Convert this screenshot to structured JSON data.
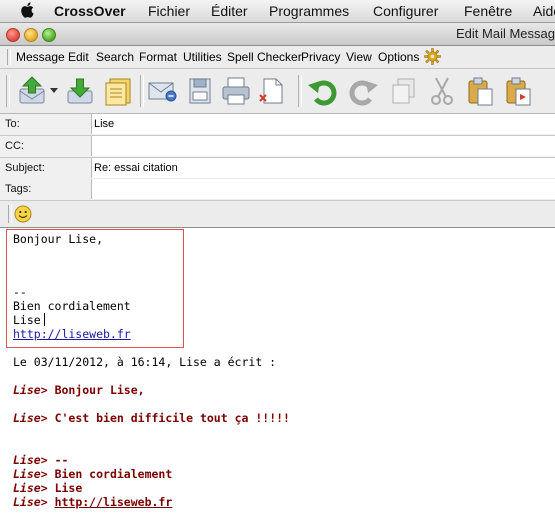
{
  "mac_menu": {
    "items": [
      "CrossOver",
      "Fichier",
      "Éditer",
      "Programmes",
      "Configurer",
      "Fenêtre",
      "Aide"
    ]
  },
  "window": {
    "title": "Edit Mail Message"
  },
  "app_menu": {
    "items": [
      "Message",
      "Edit",
      "Search",
      "Format",
      "Utilities",
      "Spell Checker",
      "Privacy",
      "View",
      "Options"
    ]
  },
  "toolbar": {
    "icons": [
      "send-icon",
      "dropdown-arrow-icon",
      "save-icon",
      "address-book-icon",
      "email-icon",
      "save-draft-icon",
      "print-icon",
      "attach-icon",
      "undo-icon",
      "redo-icon",
      "copy-icon",
      "cut-icon",
      "paste-icon",
      "paste-quote-icon"
    ]
  },
  "headers": {
    "to_label": "To:",
    "to_value": "Lise",
    "cc_label": "CC:",
    "cc_value": "",
    "subject_label": "Subject:",
    "subject_value": "Re: essai citation",
    "tags_label": "Tags:",
    "tags_value": ""
  },
  "body": {
    "greeting": "Bonjour Lise,",
    "sig_sep": "--",
    "sig_line1": "Bien cordialement",
    "sig_line2": "Lise",
    "sig_link": "http://liseweb.fr",
    "attribution": "Le 03/11/2012, à 16:14, Lise a écrit :",
    "quote_prefix": "Lise>",
    "quote_lines": [
      "Bonjour Lise,",
      "C'est bien difficile tout ça !!!!!",
      "--",
      "Bien cordialement",
      "Lise"
    ],
    "quote_link": "http://liseweb.fr"
  },
  "colors": {
    "quote": "#7a0000",
    "link": "#1a1aa6",
    "highlight_box": "#d9534f"
  }
}
